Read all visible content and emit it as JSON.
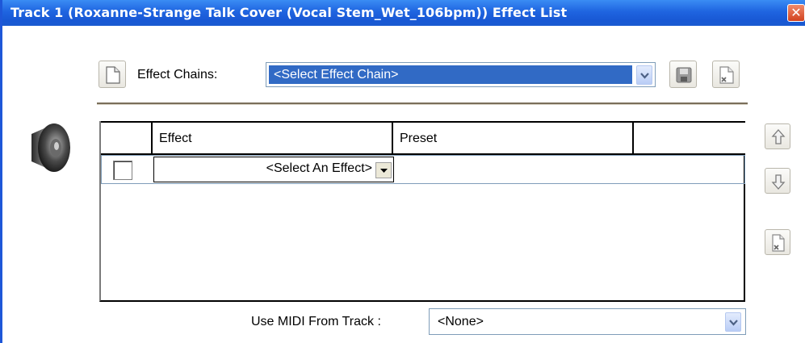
{
  "window": {
    "title": "Track 1 (Roxanne-Strange Talk Cover (Vocal Stem_Wet_106bpm)) Effect List",
    "close_glyph": "✕"
  },
  "chains": {
    "label": "Effect Chains:",
    "selected": "<Select Effect Chain>",
    "icons": [
      "new-document-icon",
      "save-disk-icon",
      "delete-document-icon"
    ]
  },
  "table": {
    "headers": [
      "",
      "Effect",
      "Preset",
      ""
    ],
    "rows": [
      {
        "checked": false,
        "effect": "<Select An Effect>",
        "preset": ""
      }
    ]
  },
  "side_buttons": [
    "move-up-icon",
    "move-down-icon",
    "remove-effect-icon"
  ],
  "midi": {
    "label": "Use MIDI From Track :",
    "selected": "<None>"
  },
  "colors": {
    "titlebar": "#1f64e0",
    "selection": "#316ac5",
    "divider": "#7a6e5a"
  }
}
